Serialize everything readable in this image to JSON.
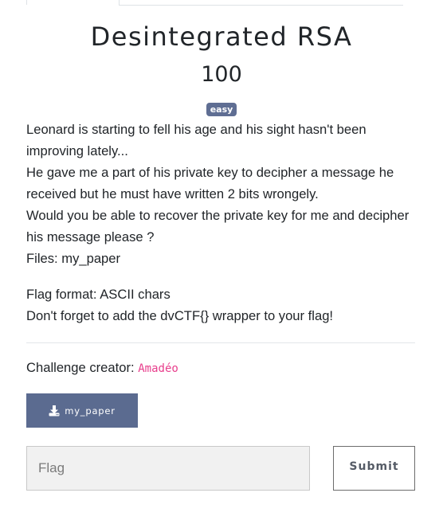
{
  "challenge": {
    "name": "Desintegrated RSA",
    "value": "100",
    "difficulty_badge": "easy",
    "description": [
      "Leonard is starting to fell his age and his sight hasn't been improving lately...",
      "He gave me a part of his private key to decipher a message he received but he must have written 2 bits wrongely.",
      "Would you be able to recover the private key for me and decipher his message please ?",
      "Files: my_paper"
    ],
    "flag_info": [
      "Flag format: ASCII chars",
      "Don't forget to add the dvCTF{} wrapper to your flag!"
    ],
    "creator_label": "Challenge creator:",
    "creator_name": "Amadéo"
  },
  "files": [
    {
      "label": "my_paper",
      "icon": "download-icon"
    }
  ],
  "submission": {
    "input_placeholder": "Flag",
    "submit_label": "Submit"
  },
  "colors": {
    "badge": "#5f6e93",
    "file_button": "#5b6b90",
    "creator_name": "#e83e8c"
  }
}
